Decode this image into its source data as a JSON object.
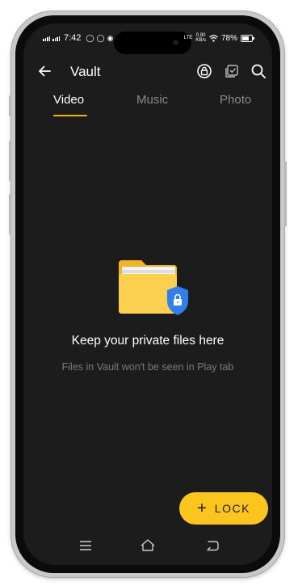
{
  "status_bar": {
    "time": "7:42",
    "battery": "78%",
    "net_speed_top": "0.90",
    "net_speed_bottom": "KB/s",
    "network_label": "LTE"
  },
  "app_bar": {
    "title": "Vault",
    "icons": [
      "back-arrow-icon",
      "lock-circle-icon",
      "select-icon",
      "search-icon"
    ]
  },
  "tabs": [
    {
      "label": "Video",
      "active": true
    },
    {
      "label": "Music",
      "active": false
    },
    {
      "label": "Photo",
      "active": false
    }
  ],
  "empty_state": {
    "title": "Keep your private files here",
    "subtitle": "Files in Vault won't be seen in Play tab",
    "illustration": "folder-with-lock-shield-icon"
  },
  "fab": {
    "icon": "+",
    "label": "LOCK"
  },
  "nav_bar": {
    "icons": [
      "menu-icon",
      "home-icon",
      "back-icon"
    ]
  },
  "colors": {
    "background": "#1c1c1c",
    "accent": "#fcc41e",
    "tab_indicator": "#f5b400",
    "shield": "#2f80ed",
    "folder": "#fbc93d"
  }
}
